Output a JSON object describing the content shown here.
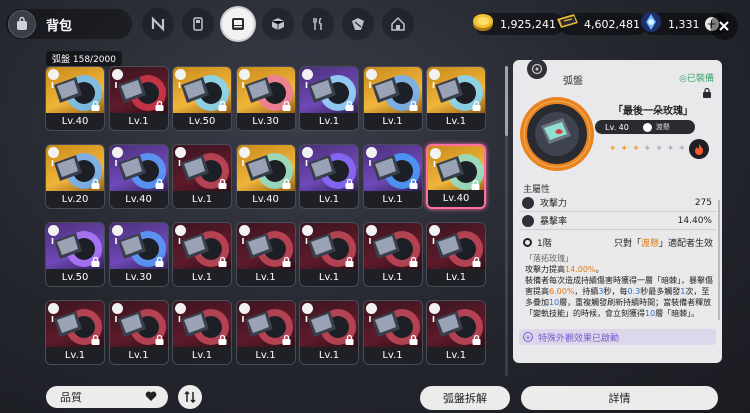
{
  "header": {
    "title": "背包",
    "currencies": [
      {
        "name": "gold-coin",
        "value": "1,925,241"
      },
      {
        "name": "ticket",
        "value": "4,602,481"
      },
      {
        "name": "blue-crystal",
        "value": "1,331"
      }
    ],
    "plus": "+"
  },
  "inventory": {
    "count_label": "弧盤 158/2000",
    "levels": [
      [
        "Lv.40",
        "Lv.1",
        "Lv.50",
        "Lv.30",
        "Lv.1",
        "Lv.1",
        "Lv.1"
      ],
      [
        "Lv.20",
        "Lv.40",
        "Lv.1",
        "Lv.40",
        "Lv.1",
        "Lv.1",
        "Lv.40"
      ],
      [
        "Lv.50",
        "Lv.30",
        "Lv.1",
        "Lv.1",
        "Lv.1",
        "Lv.1",
        "Lv.1"
      ],
      [
        "Lv.1",
        "Lv.1",
        "Lv.1",
        "Lv.1",
        "Lv.1",
        "Lv.1",
        "Lv.1"
      ]
    ],
    "tier_mark": "I"
  },
  "controls": {
    "sort_label": "品質",
    "dismantle_label": "弧盤拆解",
    "details_label": "詳情"
  },
  "detail": {
    "category": "弧盤",
    "equipped": "◎已裝備",
    "name": "「最後一朵玫瑰」",
    "level": "Lv. 40",
    "element": "渡懸",
    "stars_filled": 3,
    "stars_total": 8,
    "main_attr_title": "主屬性",
    "stats": [
      {
        "name": "攻擊力",
        "value": "275"
      },
      {
        "name": "暴擊率",
        "value": "14.40%"
      }
    ],
    "tier": "1階",
    "tier_req_pre": "只對「",
    "tier_req_hl": "渡懸",
    "tier_req_post": "」適配者生效",
    "skill_name": "「落拓玫瑰」",
    "skill_desc_1": "攻擊力提高",
    "skill_desc_1v": "14.00%",
    "skill_desc_1e": "。",
    "skill_desc_2": "裝備者每次造成持續傷害時獲得一層「暗棘」，暴擊傷害提高",
    "skill_desc_2v": "6.00%",
    "skill_desc_3": "，持續",
    "skill_desc_3v": "3",
    "skill_desc_4": "秒，每",
    "skill_desc_4v": "0.3",
    "skill_desc_5": "秒最多觸發",
    "skill_desc_5v": "1",
    "skill_desc_6": "次，至多疊加",
    "skill_desc_6v": "10",
    "skill_desc_7": "層，重複觸發刷新持續時間；當裝備者釋放「變軌技能」的時候，會立刻獲得",
    "skill_desc_7v": "10",
    "skill_desc_8": "層「暗棘」。",
    "special": "特殊外觀效果已啟動",
    "special_icon": "+"
  },
  "colors": {
    "accent_orange": "#e07b12",
    "equipped_green": "#3aa06a",
    "special_purple": "#7c5ad1",
    "selected_pink": "#ff6fa0"
  }
}
